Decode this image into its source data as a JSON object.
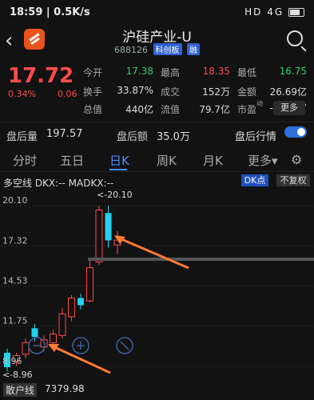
{
  "status": {
    "time": "18:59 | 0.5K/s",
    "network": "HD 4G",
    "battery_icon": "battery-icon"
  },
  "header": {
    "title": "沪硅产业-U",
    "code": "688126",
    "tag1": "科创板",
    "tag2": "融"
  },
  "quote": {
    "price": "17.72",
    "pct": "0.34%",
    "chg": "0.06",
    "rows": [
      [
        {
          "l": "今开",
          "v": "17.38",
          "c": "green"
        },
        {
          "l": "最高",
          "v": "18.35",
          "c": "red"
        },
        {
          "l": "最低",
          "v": "16.75",
          "c": "green"
        }
      ],
      [
        {
          "l": "换手",
          "v": "33.87%",
          "c": ""
        },
        {
          "l": "成交",
          "v": "152万",
          "c": ""
        },
        {
          "l": "金额",
          "v": "26.69亿",
          "c": ""
        }
      ],
      [
        {
          "l": "总值",
          "v": "440亿",
          "c": ""
        },
        {
          "l": "流值",
          "v": "79.7亿",
          "c": ""
        },
        {
          "l": "市盈",
          "v": "-204.17",
          "c": ""
        }
      ]
    ],
    "pe_sup": "动",
    "more": "更多"
  },
  "after_hours": {
    "vol_label": "盘后量",
    "vol": "197.57",
    "amt_label": "盘后额",
    "amt": "35.0万",
    "toggle_label": "盘后行情"
  },
  "tabs": [
    "分时",
    "五日",
    "日K",
    "周K",
    "月K",
    "更多▾"
  ],
  "chart": {
    "indicator": "多空线 DKX:-- MADKX:--",
    "btn_dk": "DK点",
    "btn_fq": "不复权",
    "y_labels": [
      "20.10",
      "17.32",
      "14.53",
      "11.75",
      "8.96"
    ],
    "max_label": "<-20.10",
    "min_label": "<-8.96"
  },
  "chart_data": {
    "type": "candlestick",
    "ylim": [
      8.4,
      21.0
    ],
    "candles": [
      {
        "o": 9.9,
        "c": 8.9,
        "h": 10.2,
        "l": 8.6,
        "up": false
      },
      {
        "o": 9.3,
        "c": 9.7,
        "h": 9.9,
        "l": 9.0,
        "up": true
      },
      {
        "o": 9.8,
        "c": 10.6,
        "h": 10.9,
        "l": 9.5,
        "up": true
      },
      {
        "o": 11.0,
        "c": 11.6,
        "h": 11.9,
        "l": 10.7,
        "up": false
      },
      {
        "o": 10.8,
        "c": 10.3,
        "h": 11.1,
        "l": 10.0,
        "up": true
      },
      {
        "o": 10.6,
        "c": 11.2,
        "h": 11.5,
        "l": 10.4,
        "up": true
      },
      {
        "o": 11.1,
        "c": 12.6,
        "h": 13.0,
        "l": 10.9,
        "up": true
      },
      {
        "o": 12.4,
        "c": 13.7,
        "h": 13.9,
        "l": 12.1,
        "up": true
      },
      {
        "o": 13.2,
        "c": 13.7,
        "h": 14.0,
        "l": 12.9,
        "up": false
      },
      {
        "o": 13.5,
        "c": 15.8,
        "h": 16.3,
        "l": 13.4,
        "up": true
      },
      {
        "o": 16.2,
        "c": 19.8,
        "h": 20.1,
        "l": 16.0,
        "up": true
      },
      {
        "o": 19.6,
        "c": 17.7,
        "h": 20.1,
        "l": 17.2,
        "up": false
      },
      {
        "o": 17.38,
        "c": 17.72,
        "h": 18.35,
        "l": 16.75,
        "up": true
      }
    ],
    "up_color": "#ff4b4b",
    "down_color": "#22d3ee"
  },
  "bottom": {
    "label": "散户线",
    "value": "7379.98"
  }
}
